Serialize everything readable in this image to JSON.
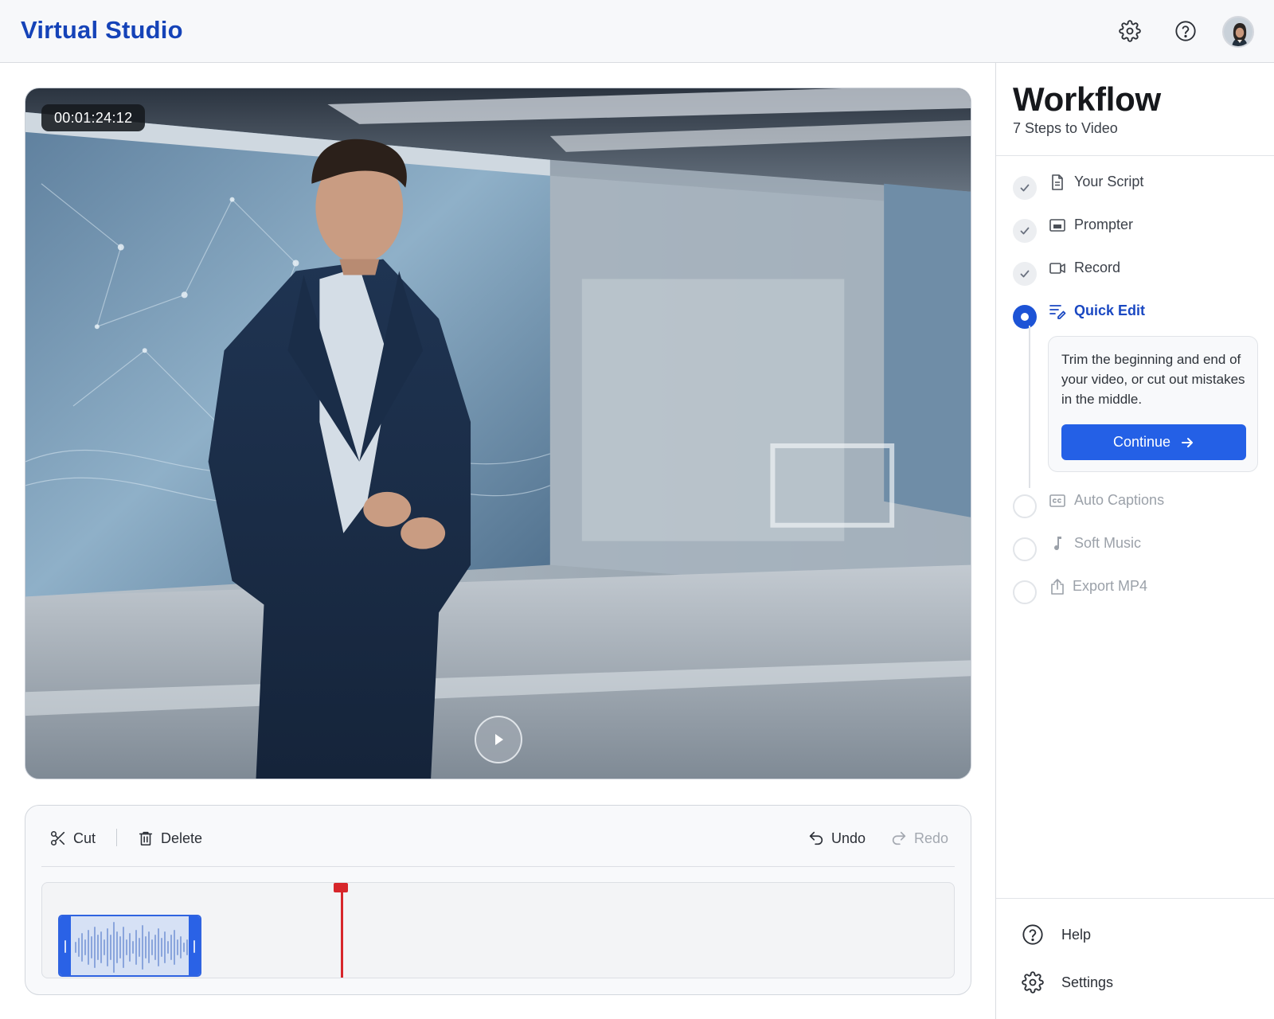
{
  "app": {
    "title": "Virtual Studio"
  },
  "header": {
    "icons": [
      "gear-icon",
      "help-icon"
    ],
    "avatar": "user-avatar"
  },
  "video": {
    "timecode": "00:01:24:12",
    "play_icon": "play-icon"
  },
  "editor": {
    "tools": {
      "cut_label": "Cut",
      "delete_label": "Delete",
      "undo_label": "Undo",
      "redo_label": "Redo"
    },
    "colors": {
      "playhead": "#d7262b",
      "clip": "#2a62e6"
    }
  },
  "workflow": {
    "title": "Workflow",
    "subtitle": "7 Steps to Video",
    "steps": [
      {
        "label": "Your Script",
        "state": "done",
        "icon": "document-icon"
      },
      {
        "label": "Prompter",
        "state": "done",
        "icon": "prompter-icon"
      },
      {
        "label": "Record",
        "state": "done",
        "icon": "video-camera-icon"
      },
      {
        "label": "Quick Edit",
        "state": "active",
        "icon": "edit-lines-icon"
      },
      {
        "label": "Auto Captions",
        "state": "pending",
        "icon": "closed-captions-icon"
      },
      {
        "label": "Soft Music",
        "state": "pending",
        "icon": "music-note-icon"
      },
      {
        "label": "Export MP4",
        "state": "pending",
        "icon": "share-export-icon"
      }
    ],
    "active_card": {
      "text": "Trim the beginning and end of your video, or cut out mistakes in the middle.",
      "button_label": "Continue"
    },
    "accent": "#1c53d6"
  },
  "sidebar_footer": {
    "help_label": "Help",
    "settings_label": "Settings"
  }
}
